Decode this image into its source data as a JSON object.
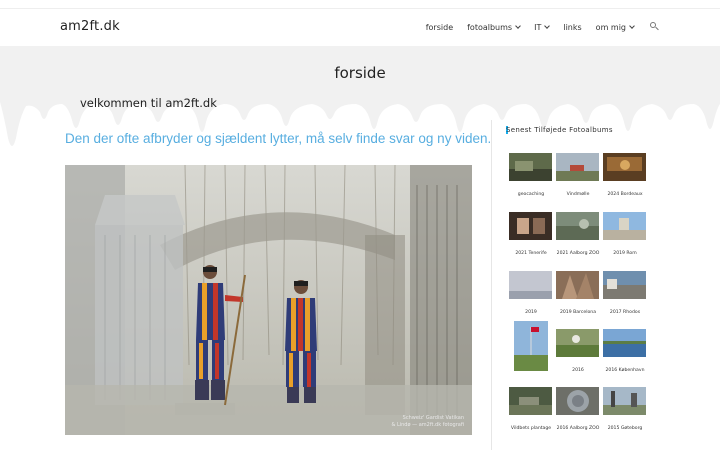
{
  "site": {
    "logo": "am2ft.dk"
  },
  "nav": [
    {
      "label": "forside",
      "dropdown": false
    },
    {
      "label": "fotoalbums",
      "dropdown": true
    },
    {
      "label": "IT",
      "dropdown": true
    },
    {
      "label": "links",
      "dropdown": false
    },
    {
      "label": "om mig",
      "dropdown": true
    }
  ],
  "page": {
    "title": "forside",
    "welcome": "velkommen til am2ft.dk",
    "tagline": "Den der ofte afbryder og sjældent lytter, må selv finde svar og ny viden.",
    "photo_caption_line1": "Schweiz'  Gardist  Vatikan",
    "photo_caption_line2": "& Lindø  —  am2ft.dk fotografi"
  },
  "sidebar": {
    "widget_title": "Senest Tilføjede Fotoalbums",
    "accent_color": "#13aff0",
    "albums": [
      {
        "label": "geocaching"
      },
      {
        "label": "Vindmølle"
      },
      {
        "label": "2024 Bordeaux"
      },
      {
        "label": "2021 Tenerife"
      },
      {
        "label": "2021 Aalborg ZOO"
      },
      {
        "label": "2019 Rom"
      },
      {
        "label": "2019"
      },
      {
        "label": "2019 Barcelona"
      },
      {
        "label": "2017 Rhodos"
      },
      {
        "label": ""
      },
      {
        "label": "2016"
      },
      {
        "label": "2016 København"
      },
      {
        "label": "Vildbets plantage"
      },
      {
        "label": "2016 Aalborg ZOO"
      },
      {
        "label": "2015 Gøteborg"
      }
    ]
  },
  "colors": {
    "tagline": "#58aee0",
    "title_band": "#f1f1f1"
  }
}
